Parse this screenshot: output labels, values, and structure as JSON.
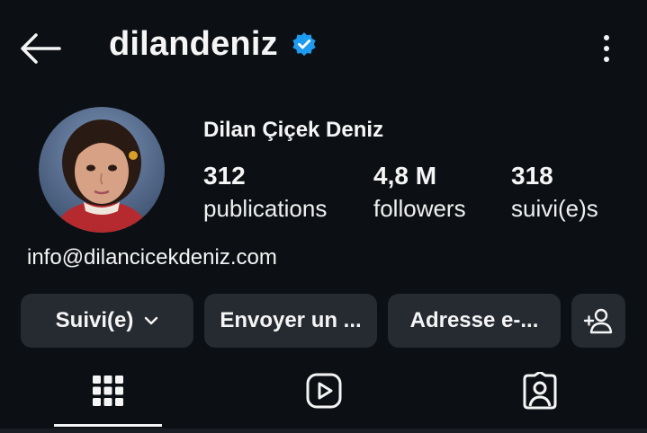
{
  "header": {
    "username": "dilandeniz",
    "verified": true
  },
  "profile": {
    "full_name": "Dilan Çiçek Deniz",
    "stats": [
      {
        "value": "312",
        "label": "publications"
      },
      {
        "value": "4,8 M",
        "label": "followers"
      },
      {
        "value": "318",
        "label": "suivi(e)s"
      }
    ],
    "contact": "info@dilancicekdeniz.com"
  },
  "actions": {
    "following_label": "Suivi(e)",
    "message_label": "Envoyer un ...",
    "email_label": "Adresse e-..."
  },
  "tabs": {
    "active": "grid",
    "items": [
      "grid-icon",
      "reels-icon",
      "tagged-icon"
    ]
  },
  "colors": {
    "background": "#0c1014",
    "button_bg": "#262a31",
    "verified_blue": "#1d9bf0",
    "text": "#f5f5f5"
  }
}
